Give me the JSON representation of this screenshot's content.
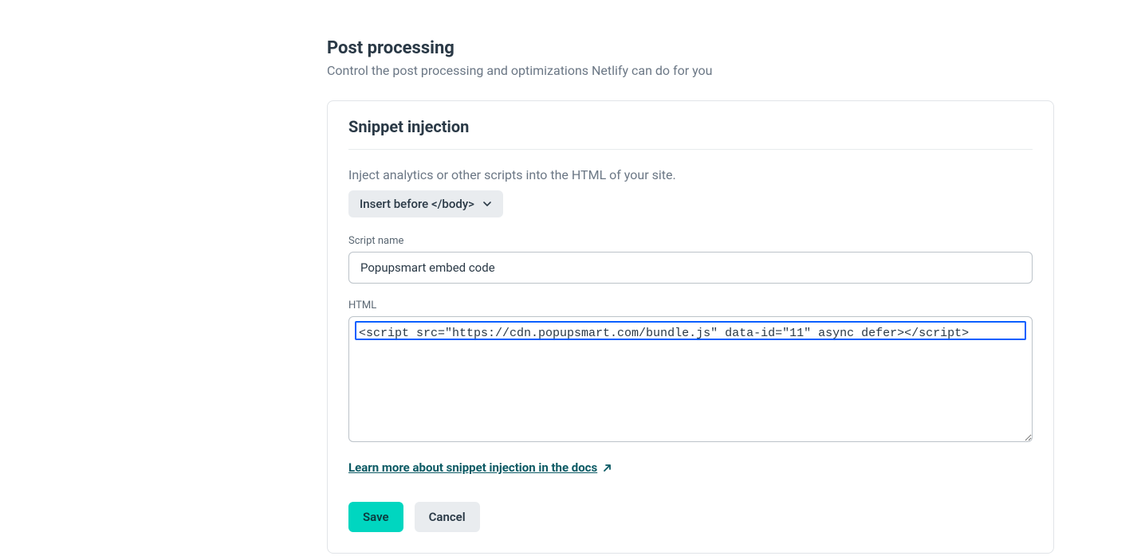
{
  "header": {
    "title": "Post processing",
    "subtitle": "Control the post processing and optimizations Netlify can do for you"
  },
  "card": {
    "title": "Snippet injection",
    "helper_text": "Inject analytics or other scripts into the HTML of your site.",
    "position_select": {
      "selected_label": "Insert before </body>"
    },
    "script_name": {
      "label": "Script name",
      "value": "Popupsmart embed code"
    },
    "html_field": {
      "label": "HTML",
      "value": "<script src=\"https://cdn.popupsmart.com/bundle.js\" data-id=\"11\" async defer></script>"
    },
    "doc_link": {
      "text": "Learn more about snippet injection in the docs"
    },
    "buttons": {
      "save": "Save",
      "cancel": "Cancel"
    }
  }
}
